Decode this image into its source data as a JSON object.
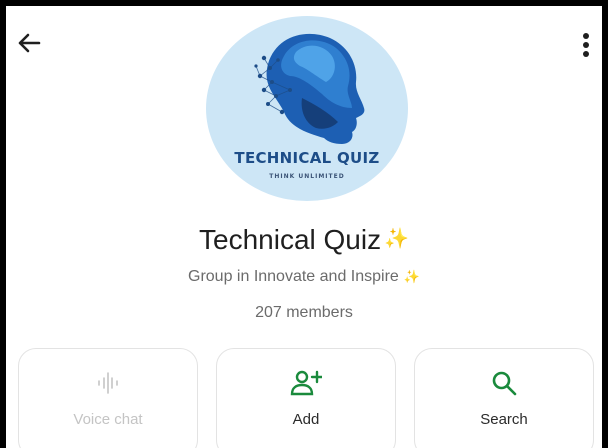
{
  "header": {
    "back_icon": "arrow-left-icon",
    "menu_icon": "more-vertical-icon"
  },
  "logo": {
    "title": "TECHNICAL QUIZ",
    "tagline": "THINK UNLIMITED",
    "colors": {
      "background": "#cde6f6",
      "primary": "#1d5fb3",
      "light": "#4fa3e8"
    }
  },
  "group": {
    "name": "Technical Quiz",
    "name_emoji": "✨",
    "subtitle": "Group in Innovate and Inspire",
    "subtitle_emoji": "✨",
    "members": "207 members"
  },
  "actions": [
    {
      "label": "Voice chat",
      "icon": "voice-wave-icon",
      "enabled": false
    },
    {
      "label": "Add",
      "icon": "add-person-icon",
      "enabled": true
    },
    {
      "label": "Search",
      "icon": "search-icon",
      "enabled": true
    }
  ],
  "colors": {
    "accent": "#1a8a3c",
    "disabled": "#c4c4c4"
  }
}
